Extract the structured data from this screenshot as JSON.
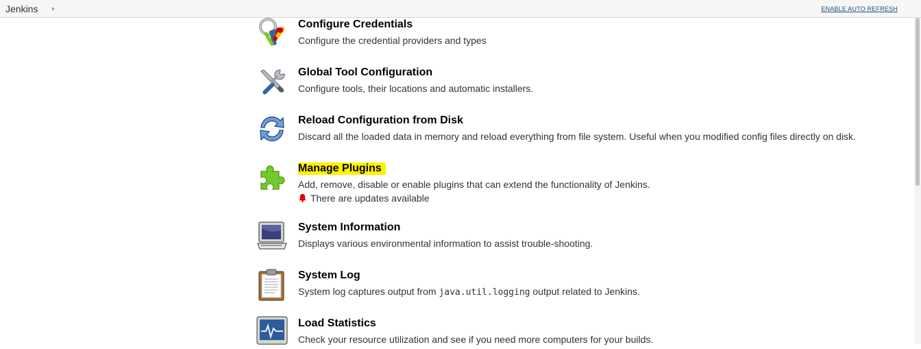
{
  "breadcrumb": {
    "root": "Jenkins"
  },
  "header": {
    "auto_refresh": "ENABLE AUTO REFRESH"
  },
  "items": [
    {
      "title": "Configure Credentials",
      "description": "Configure the credential providers and types",
      "icon": "keys-icon"
    },
    {
      "title": "Global Tool Configuration",
      "description": "Configure tools, their locations and automatic installers.",
      "icon": "tools-icon"
    },
    {
      "title": "Reload Configuration from Disk",
      "description": "Discard all the loaded data in memory and reload everything from file system. Useful when you modified config files directly on disk.",
      "icon": "reload-icon"
    },
    {
      "title": "Manage Plugins",
      "description": "Add, remove, disable or enable plugins that can extend the functionality of Jenkins.",
      "notice": "There are updates available",
      "icon": "puzzle-icon",
      "highlight_color": "#fff200"
    },
    {
      "title": "System Information",
      "description": "Displays various environmental information to assist trouble-shooting.",
      "icon": "computer-icon"
    },
    {
      "title": "System Log",
      "description_before": "System log captures output from",
      "description_code": "java.util.logging",
      "description_after": "output related to Jenkins.",
      "icon": "clipboard-icon"
    },
    {
      "title": "Load Statistics",
      "description": "Check your resource utilization and see if you need more computers for your builds.",
      "icon": "monitor-graph-icon"
    }
  ],
  "colors": {
    "link": "#204a87",
    "highlight": "#fff200",
    "alert": "#e00000"
  }
}
